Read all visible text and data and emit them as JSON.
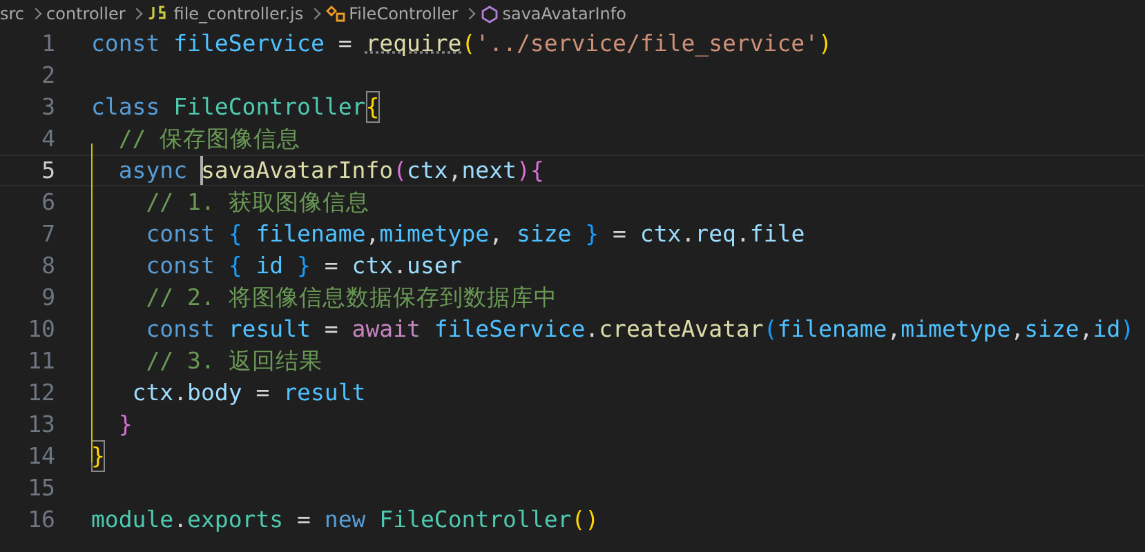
{
  "breadcrumb": [
    {
      "label": "src",
      "kind": "folder"
    },
    {
      "label": "controller",
      "kind": "folder"
    },
    {
      "label": "file_controller.js",
      "kind": "js"
    },
    {
      "label": "FileController",
      "kind": "class"
    },
    {
      "label": "savaAvatarInfo",
      "kind": "method"
    }
  ],
  "editor": {
    "lines": [
      {
        "number": "1",
        "current": false,
        "tokens": [
          {
            "text": "const ",
            "kind": "keyword"
          },
          {
            "text": "fileService",
            "kind": "constant"
          },
          {
            "text": " = ",
            "kind": "plain"
          },
          {
            "text": "require",
            "kind": "function",
            "hint": true
          },
          {
            "text": "(",
            "kind": "bracket1"
          },
          {
            "text": "'../service/file_service'",
            "kind": "string"
          },
          {
            "text": ")",
            "kind": "bracket1"
          }
        ]
      },
      {
        "number": "2",
        "current": false
      },
      {
        "number": "3",
        "current": false,
        "tokens": [
          {
            "text": "class ",
            "kind": "keyword"
          },
          {
            "text": "FileController",
            "kind": "class"
          },
          {
            "text": "{",
            "kind": "bracket1",
            "matched": true
          }
        ]
      },
      {
        "number": "4",
        "current": false,
        "tokens": [
          {
            "text": "  // 保存图像信息",
            "kind": "comment"
          }
        ]
      },
      {
        "number": "5",
        "current": true,
        "tokens": [
          {
            "text": "  async ",
            "kind": "keyword"
          },
          {
            "text": "savaAvatarInfo",
            "kind": "function",
            "cursor": true
          },
          {
            "text": "(",
            "kind": "bracket2"
          },
          {
            "text": "ctx",
            "kind": "variable"
          },
          {
            "text": ",",
            "kind": "plain"
          },
          {
            "text": "next",
            "kind": "variable"
          },
          {
            "text": ")",
            "kind": "bracket2"
          },
          {
            "text": "{",
            "kind": "bracket2"
          }
        ]
      },
      {
        "number": "6",
        "current": false,
        "tokens": [
          {
            "text": "    // 1. 获取图像信息",
            "kind": "comment"
          }
        ]
      },
      {
        "number": "7",
        "current": false,
        "tokens": [
          {
            "text": "    const ",
            "kind": "keyword"
          },
          {
            "text": "{ ",
            "kind": "bracket3"
          },
          {
            "text": "filename",
            "kind": "constant"
          },
          {
            "text": ",",
            "kind": "plain"
          },
          {
            "text": "mimetype",
            "kind": "constant"
          },
          {
            "text": ", ",
            "kind": "plain"
          },
          {
            "text": "size ",
            "kind": "constant"
          },
          {
            "text": "}",
            "kind": "bracket3"
          },
          {
            "text": " = ",
            "kind": "plain"
          },
          {
            "text": "ctx",
            "kind": "variable"
          },
          {
            "text": ".",
            "kind": "plain"
          },
          {
            "text": "req",
            "kind": "variable"
          },
          {
            "text": ".",
            "kind": "plain"
          },
          {
            "text": "file",
            "kind": "variable"
          }
        ]
      },
      {
        "number": "8",
        "current": false,
        "tokens": [
          {
            "text": "    const ",
            "kind": "keyword"
          },
          {
            "text": "{ ",
            "kind": "bracket3"
          },
          {
            "text": "id ",
            "kind": "constant"
          },
          {
            "text": "}",
            "kind": "bracket3"
          },
          {
            "text": " = ",
            "kind": "plain"
          },
          {
            "text": "ctx",
            "kind": "variable"
          },
          {
            "text": ".",
            "kind": "plain"
          },
          {
            "text": "user",
            "kind": "variable"
          }
        ]
      },
      {
        "number": "9",
        "current": false,
        "tokens": [
          {
            "text": "    // 2. 将图像信息数据保存到数据库中",
            "kind": "comment"
          }
        ]
      },
      {
        "number": "10",
        "current": false,
        "tokens": [
          {
            "text": "    const ",
            "kind": "keyword"
          },
          {
            "text": "result",
            "kind": "constant"
          },
          {
            "text": " = ",
            "kind": "plain"
          },
          {
            "text": "await ",
            "kind": "control"
          },
          {
            "text": "fileService",
            "kind": "constant"
          },
          {
            "text": ".",
            "kind": "plain"
          },
          {
            "text": "createAvatar",
            "kind": "function"
          },
          {
            "text": "(",
            "kind": "bracket3"
          },
          {
            "text": "filename",
            "kind": "constant"
          },
          {
            "text": ",",
            "kind": "plain"
          },
          {
            "text": "mimetype",
            "kind": "constant"
          },
          {
            "text": ",",
            "kind": "plain"
          },
          {
            "text": "size",
            "kind": "constant"
          },
          {
            "text": ",",
            "kind": "plain"
          },
          {
            "text": "id",
            "kind": "constant"
          },
          {
            "text": ")",
            "kind": "bracket3"
          }
        ]
      },
      {
        "number": "11",
        "current": false,
        "tokens": [
          {
            "text": "    // 3. 返回结果",
            "kind": "comment"
          }
        ]
      },
      {
        "number": "12",
        "current": false,
        "tokens": [
          {
            "text": "   ctx",
            "kind": "variable"
          },
          {
            "text": ".",
            "kind": "plain"
          },
          {
            "text": "body",
            "kind": "variable"
          },
          {
            "text": " = ",
            "kind": "plain"
          },
          {
            "text": "result",
            "kind": "constant"
          }
        ]
      },
      {
        "number": "13",
        "current": false,
        "tokens": [
          {
            "text": "  }",
            "kind": "bracket2"
          }
        ]
      },
      {
        "number": "14",
        "current": false,
        "tokens": [
          {
            "text": "}",
            "kind": "bracket1",
            "matched": true
          }
        ]
      },
      {
        "number": "15",
        "current": false
      },
      {
        "number": "16",
        "current": false,
        "tokens": [
          {
            "text": "module",
            "kind": "class"
          },
          {
            "text": ".",
            "kind": "plain"
          },
          {
            "text": "exports",
            "kind": "class"
          },
          {
            "text": " = ",
            "kind": "plain"
          },
          {
            "text": "new ",
            "kind": "keyword"
          },
          {
            "text": "FileController",
            "kind": "class"
          },
          {
            "text": "()",
            "kind": "bracket1"
          }
        ]
      }
    ]
  }
}
